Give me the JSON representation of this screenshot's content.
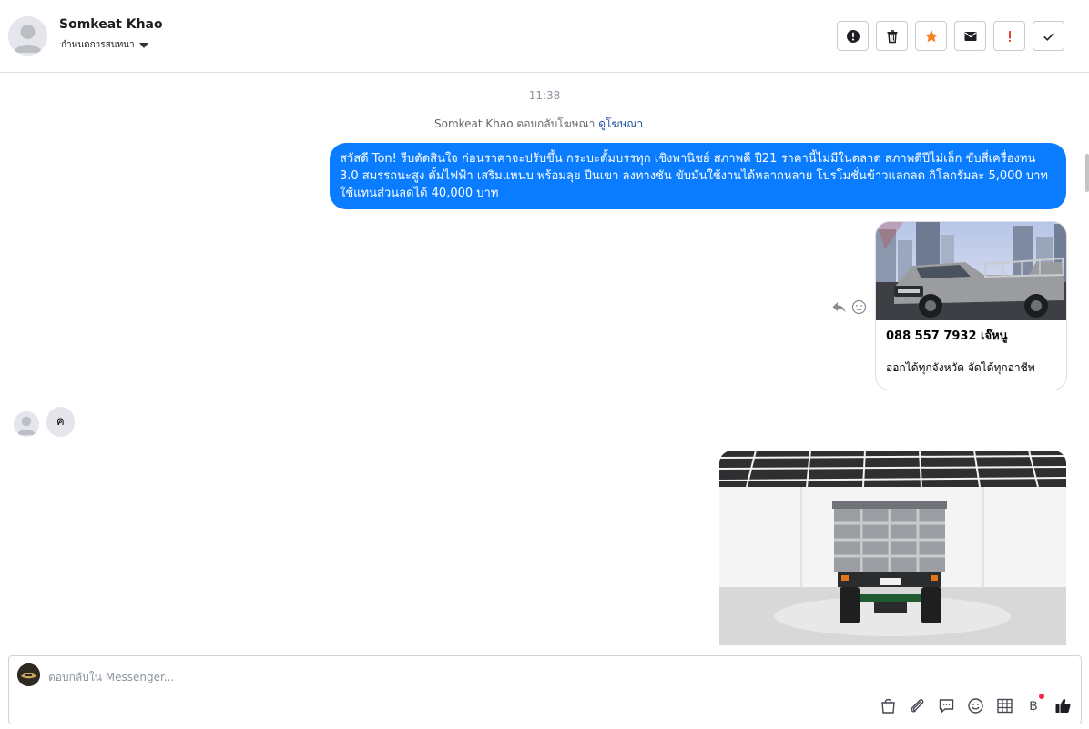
{
  "header": {
    "contact_name": "Somkeat Khao",
    "assign_label": "กำหนดการสนทนา",
    "actions": [
      {
        "name": "mark-spam-button",
        "icon": "alert-circle-icon"
      },
      {
        "name": "delete-button",
        "icon": "trash-icon"
      },
      {
        "name": "star-button",
        "icon": "star-icon"
      },
      {
        "name": "mark-unread-button",
        "icon": "envelope-icon"
      },
      {
        "name": "follow-up-button",
        "icon": "exclamation-icon"
      },
      {
        "name": "mark-done-button",
        "icon": "check-icon"
      }
    ],
    "colors": {
      "star": "#f5821f",
      "follow_up": "#e0301e"
    }
  },
  "conversation": {
    "timestamp": "11:38",
    "ad_reply_note": "Somkeat Khao ตอบกลับโฆษณา",
    "ad_reply_link": "ดูโฆษณา",
    "outgoing_message": "สวัสดี Ton! รีบตัดสินใจ ก่อนราคาจะปรับขึ้น กระบะดั้มบรรทุก เชิงพานิชย์ สภาพดี ปี21  ราคานี้ไม่มีในตลาด สภาพดีปีไม่เล็ก ขับสี่เครื่องทน 3.0 สมรรถนะสูง ดั้มไฟฟ้า เสริมแหนบ พร้อมลุย ปีนเขา ลงทางชัน ขับมันใช้งานได้หลากหลาย โปรโมชั่นข้าวแลกลด กิโลกรัมละ 5,000 บาท ใช้แทนส่วนลดได้ 40,000 บาท",
    "ad_card": {
      "title": "088 557 7932 เจ๊หนู",
      "subtitle": "ออกได้ทุกจังหวัด จัดได้ทุกอาชีพ",
      "image": "pickup-truck-photo"
    },
    "incoming_message": "ค",
    "photo": "dump-truck-rear-photo",
    "colors": {
      "outgoing_bubble": "#0a7cff",
      "incoming_bubble": "#e4e6eb",
      "link": "#1d4ea0"
    }
  },
  "composer": {
    "placeholder": "ตอบกลับใน Messenger...",
    "value": "",
    "baht_symbol": "฿",
    "tools": [
      "shopping-bag-icon",
      "paperclip-icon",
      "saved-reply-icon",
      "emoji-icon",
      "table-icon",
      "baht-icon",
      "thumbs-up-icon"
    ]
  }
}
